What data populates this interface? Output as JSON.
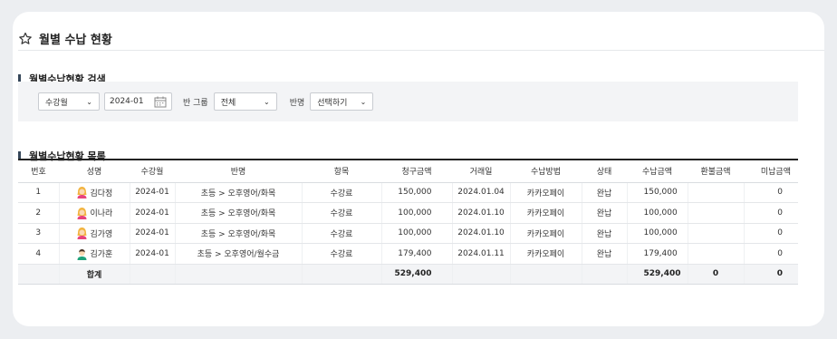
{
  "page": {
    "title": "월별 수납 현황"
  },
  "search": {
    "section_title": "월별수납현황 검색",
    "type_select": "수강월",
    "date_value": "2024-01",
    "group_label": "반 그룹",
    "group_select": "전체",
    "class_label": "반명",
    "class_select": "선택하기"
  },
  "list": {
    "section_title": "월별수납현황 목록",
    "headers": [
      "번호",
      "성명",
      "수강월",
      "반명",
      "항목",
      "청구금액",
      "거래일",
      "수납방법",
      "상태",
      "수납금액",
      "환불금액",
      "미납금액"
    ],
    "rows": [
      {
        "no": "1",
        "name": "김다정",
        "avatar": "female-avatar-icon",
        "month": "2024-01",
        "class": "초등 > 오후영어/화목",
        "item": "수강료",
        "billed": "150,000",
        "date": "2024.01.04",
        "method": "카카오페이",
        "status": "완납",
        "paid": "150,000",
        "refund": "",
        "unpaid": "0"
      },
      {
        "no": "2",
        "name": "이나라",
        "avatar": "female-avatar-icon",
        "month": "2024-01",
        "class": "초등 > 오후영어/화목",
        "item": "수강료",
        "billed": "100,000",
        "date": "2024.01.10",
        "method": "카카오페이",
        "status": "완납",
        "paid": "100,000",
        "refund": "",
        "unpaid": "0"
      },
      {
        "no": "3",
        "name": "김가영",
        "avatar": "female-avatar-icon",
        "month": "2024-01",
        "class": "초등 > 오후영어/화목",
        "item": "수강료",
        "billed": "100,000",
        "date": "2024.01.10",
        "method": "카카오페이",
        "status": "완납",
        "paid": "100,000",
        "refund": "",
        "unpaid": "0"
      },
      {
        "no": "4",
        "name": "김가훈",
        "avatar": "male-avatar-icon",
        "month": "2024-01",
        "class": "초등 > 오후영어/월수금",
        "item": "수강료",
        "billed": "179,400",
        "date": "2024.01.11",
        "method": "카카오페이",
        "status": "완납",
        "paid": "179,400",
        "refund": "",
        "unpaid": "0"
      }
    ],
    "summary": {
      "label": "합계",
      "billed": "529,400",
      "paid": "529,400",
      "refund": "0",
      "unpaid": "0"
    }
  }
}
